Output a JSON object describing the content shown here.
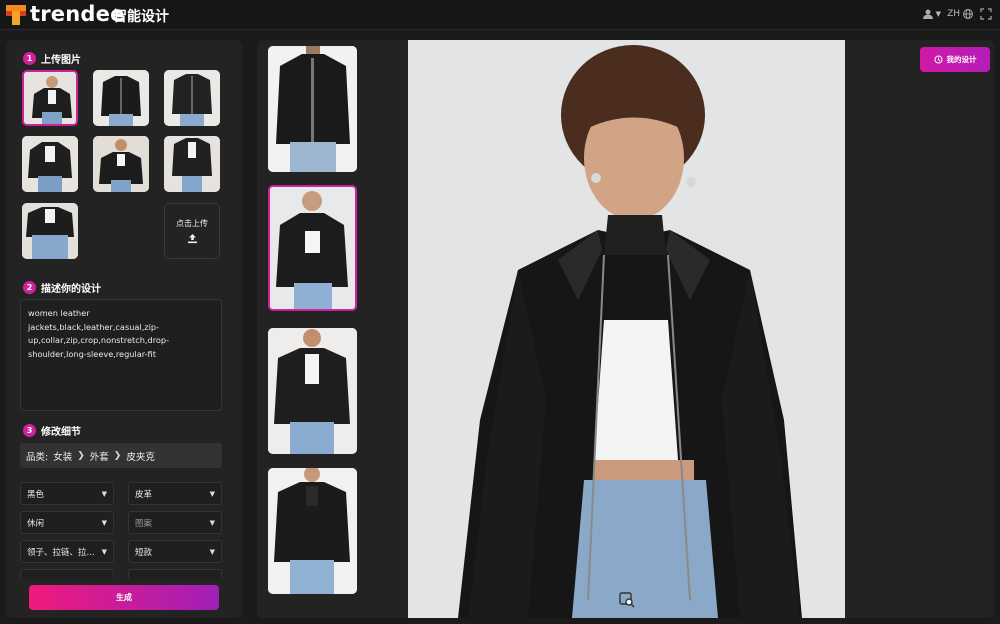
{
  "header": {
    "brand": "trendee",
    "app_title": "智能设计",
    "lang": "ZH"
  },
  "left": {
    "section1": {
      "num": "1",
      "title": "上传图片"
    },
    "upload_label": "点击上传",
    "section2": {
      "num": "2",
      "title": "描述你的设计"
    },
    "description_lines": [
      "women leather",
      "jackets,black,leather,casual,zip-",
      "up,collar,zip,crop,nonstretch,drop-",
      "shoulder,long-sleeve,regular-fit"
    ],
    "section3": {
      "num": "3",
      "title": "修改细节"
    },
    "category": {
      "label": "品类:",
      "items": [
        "女装",
        "外套",
        "皮夹克"
      ]
    },
    "selects": [
      {
        "value": "黑色"
      },
      {
        "value": "皮革"
      },
      {
        "value": "休闲"
      },
      {
        "value": "图案"
      },
      {
        "value": "领子、拉链、拉..."
      },
      {
        "value": "短款"
      }
    ],
    "generate_label": "生成"
  },
  "right": {
    "my_design_label": "我的设计"
  },
  "colors": {
    "accent": "#d0209a",
    "bg": "#1b1b1b",
    "panel": "#232323"
  }
}
